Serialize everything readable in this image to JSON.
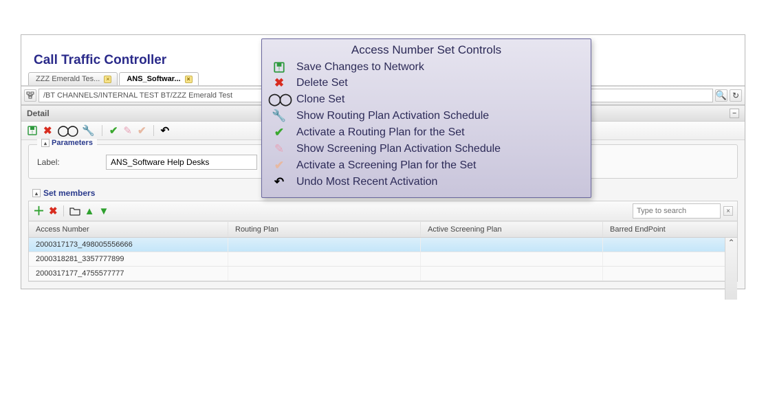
{
  "app": {
    "title": "Call Traffic Controller"
  },
  "tabs": [
    {
      "label": "ZZZ Emerald Tes..."
    },
    {
      "label": "ANS_Softwar..."
    }
  ],
  "breadcrumb": {
    "path": "/BT CHANNELS/INTERNAL TEST BT/ZZZ Emerald Test"
  },
  "detail": {
    "header": "Detail"
  },
  "parameters": {
    "legend": "Parameters",
    "label_caption": "Label:",
    "label_value": "ANS_Software Help Desks"
  },
  "members": {
    "legend": "Set members",
    "search_placeholder": "Type to search",
    "columns": {
      "access": "Access Number",
      "routing": "Routing Plan",
      "screening": "Active Screening Plan",
      "barred": "Barred EndPoint"
    },
    "rows": [
      {
        "access": "2000317173_498005556666",
        "routing": "",
        "screening": "",
        "barred": ""
      },
      {
        "access": "2000318281_3357777899",
        "routing": "",
        "screening": "",
        "barred": ""
      },
      {
        "access": "2000317177_4755577777",
        "routing": "",
        "screening": "",
        "barred": ""
      }
    ],
    "selected_index": 0
  },
  "popup": {
    "title": "Access Number Set Controls",
    "items": [
      {
        "icon": "save-icon",
        "label": "Save Changes to Network"
      },
      {
        "icon": "delete-icon",
        "label": "Delete Set"
      },
      {
        "icon": "clone-icon",
        "label": "Clone Set"
      },
      {
        "icon": "wrench-icon",
        "label": "Show Routing Plan Activation Schedule"
      },
      {
        "icon": "check-icon",
        "label": "Activate a Routing Plan for the Set"
      },
      {
        "icon": "pin-icon",
        "label": "Show Screening Plan Activation Schedule"
      },
      {
        "icon": "lightcheck-icon",
        "label": "Activate a Screening Plan for the Set"
      },
      {
        "icon": "undo-icon",
        "label": "Undo Most Recent Activation"
      }
    ]
  }
}
